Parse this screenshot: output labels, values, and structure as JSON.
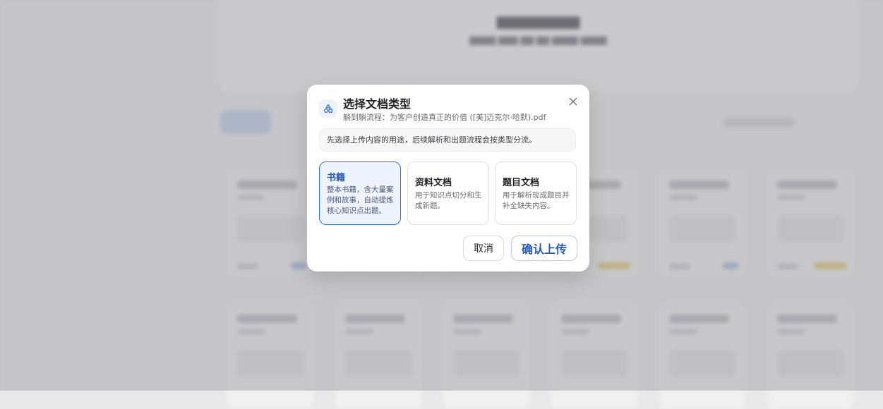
{
  "modal": {
    "title": "选择文档类型",
    "subtitle": "躺到躺流程：为客户创造真正的价值 ([美]迈克尔·哈默).pdf",
    "hint": "先选择上传内容的用途，后续解析和出题流程会按类型分流。",
    "icon": "shapes-icon",
    "close_icon": "close-icon",
    "options": [
      {
        "title": "书籍",
        "desc": "整本书籍，含大量案例和故事，自动提炼核心知识点出题。",
        "selected": true
      },
      {
        "title": "资料文档",
        "desc": "用于知识点切分和生成新题。",
        "selected": false
      },
      {
        "title": "题目文档",
        "desc": "用于解析现成题目并补全缺失内容。",
        "selected": false
      }
    ],
    "cancel_label": "取消",
    "confirm_label": "确认上传"
  },
  "colors": {
    "accent": "#2f6fd6",
    "selected_bg": "#eef4ff"
  }
}
